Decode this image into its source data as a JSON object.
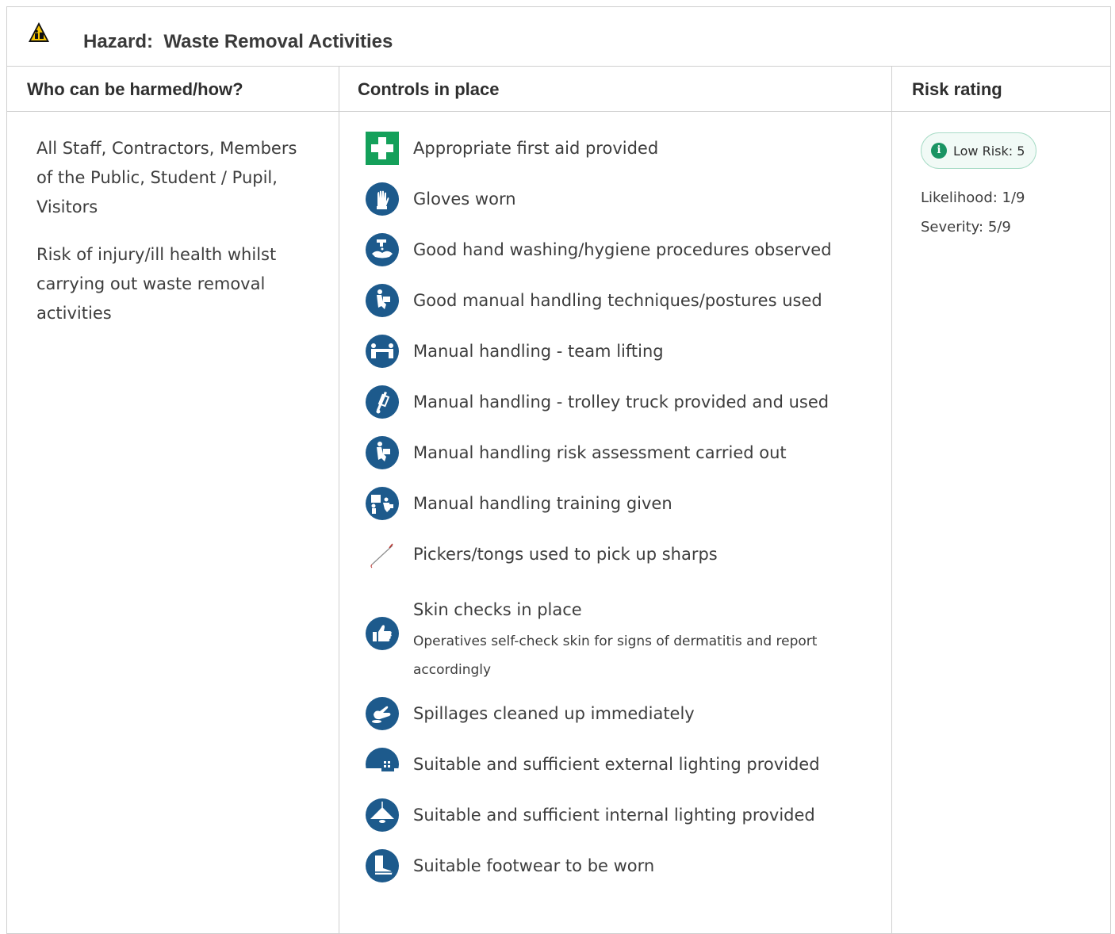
{
  "hazard": {
    "label": "Hazard:",
    "name": "Waste Removal Activities",
    "icon": "warning-triangle-icon"
  },
  "columns": {
    "who": "Who can be harmed/how?",
    "controls": "Controls in place",
    "risk": "Risk rating"
  },
  "who": {
    "people": "All Staff, Contractors, Members of the Public, Student / Pupil, Visitors",
    "how": "Risk of injury/ill health whilst carrying out waste removal activities"
  },
  "controls": [
    {
      "label": "Appropriate first aid provided",
      "icon": "first-aid-icon"
    },
    {
      "label": "Gloves worn",
      "icon": "gloves-icon"
    },
    {
      "label": "Good hand washing/hygiene procedures observed",
      "icon": "hand-washing-icon"
    },
    {
      "label": "Good manual handling techniques/postures used",
      "icon": "lifting-posture-icon"
    },
    {
      "label": "Manual handling - team lifting",
      "icon": "team-lifting-icon"
    },
    {
      "label": "Manual handling - trolley truck provided and used",
      "icon": "trolley-truck-icon"
    },
    {
      "label": "Manual handling risk assessment carried out",
      "icon": "lifting-posture-icon"
    },
    {
      "label": "Manual handling training given",
      "icon": "training-icon"
    },
    {
      "label": "Pickers/tongs used to pick up sharps",
      "icon": "picker-tongs-icon"
    },
    {
      "label": "Skin checks in place",
      "note": "Operatives self-check skin for signs of dermatitis and report accordingly",
      "icon": "thumbs-up-icon"
    },
    {
      "label": "Spillages cleaned up immediately",
      "icon": "spillage-cleanup-icon"
    },
    {
      "label": "Suitable and sufficient external lighting provided",
      "icon": "external-lighting-icon"
    },
    {
      "label": "Suitable and sufficient internal lighting provided",
      "icon": "ceiling-lamp-icon"
    },
    {
      "label": "Suitable footwear to be worn",
      "icon": "safety-boot-icon"
    }
  ],
  "risk": {
    "badge": "Low Risk: 5",
    "likelihood": "Likelihood: 1/9",
    "severity": "Severity: 5/9",
    "badge_color": "#1a9463"
  },
  "colors": {
    "icon_blue": "#1d5a8c",
    "first_aid_green": "#14a05a",
    "warning_yellow": "#f5c400",
    "border": "#cfcfcf"
  }
}
